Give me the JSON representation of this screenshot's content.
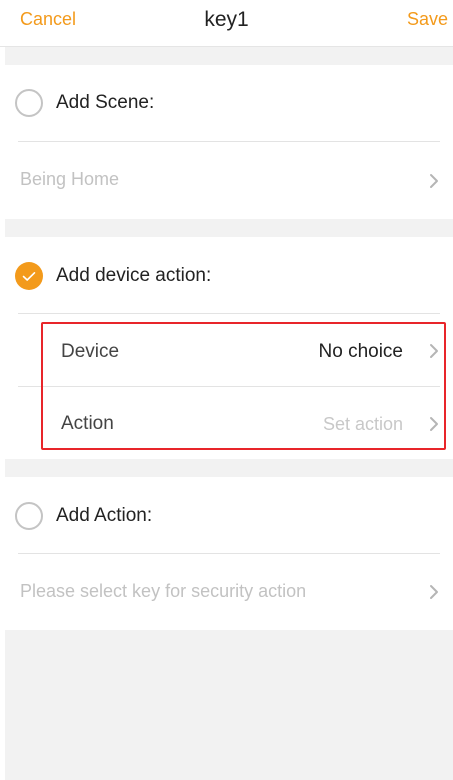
{
  "header": {
    "cancel_label": "Cancel",
    "title": "key1",
    "save_label": "Save"
  },
  "scene_section": {
    "option_label": "Add Scene:",
    "checked": false,
    "value": "Being Home"
  },
  "device_section": {
    "option_label": "Add device action:",
    "checked": true,
    "device_label": "Device",
    "device_value": "No choice",
    "action_label": "Action",
    "action_placeholder": "Set action"
  },
  "action_section": {
    "option_label": "Add Action:",
    "checked": false,
    "value": "Please select key for security action"
  },
  "colors": {
    "accent": "#f39a1b",
    "highlight": "#e8252a",
    "separator": "#f2f2f2",
    "muted_text": "#c2c2c2"
  },
  "icons": {
    "check": "check-icon",
    "chevron": "chevron-right-icon"
  }
}
